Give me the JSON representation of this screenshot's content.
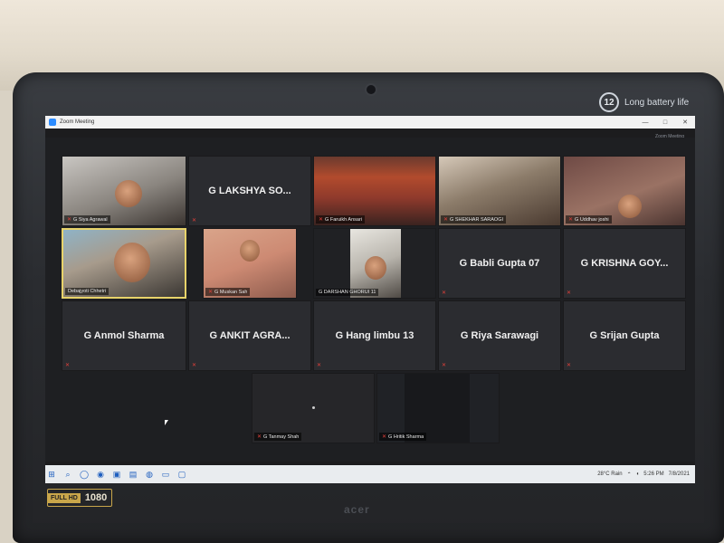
{
  "device": {
    "battery_badge_number": "12",
    "battery_badge_text": "Long battery life",
    "hd_badge_label": "FULL HD",
    "hd_badge_resolution": "1080",
    "brand": "acer"
  },
  "window": {
    "title": "Zoom Meeting",
    "controls": {
      "minimize": "—",
      "maximize": "□",
      "close": "✕"
    },
    "top_info": "Zoom Meeting"
  },
  "participants": [
    {
      "name": "G Siya Agrawal",
      "display": "video"
    },
    {
      "name": "G LAKSHYA SO...",
      "display": "name"
    },
    {
      "name": "G Faruikh Ansari",
      "display": "video"
    },
    {
      "name": "G SHEKHAR SARAOGI",
      "display": "video"
    },
    {
      "name": "G Uddhav joshi",
      "display": "video"
    },
    {
      "name": "Debajyoti Chhetri",
      "display": "video"
    },
    {
      "name": "G Muskan Sah",
      "display": "video"
    },
    {
      "name": "G DARSHAN GHORUI 11",
      "display": "video"
    },
    {
      "name": "G Babli Gupta 07",
      "display": "name"
    },
    {
      "name": "G KRISHNA GOY...",
      "display": "name"
    },
    {
      "name": "G Anmol Sharma",
      "display": "name"
    },
    {
      "name": "G ANKIT AGRA...",
      "display": "name"
    },
    {
      "name": "G Hang limbu 13",
      "display": "name"
    },
    {
      "name": "G Riya Sarawagi",
      "display": "name"
    },
    {
      "name": "G Srijan Gupta",
      "display": "name"
    },
    {
      "name": "G Tanmay Shah",
      "display": "video"
    },
    {
      "name": "G Hritik Sharma",
      "display": "video"
    }
  ],
  "taskbar": {
    "weather": "28°C Rain",
    "time": "5:26 PM",
    "date": "7/8/2021"
  }
}
